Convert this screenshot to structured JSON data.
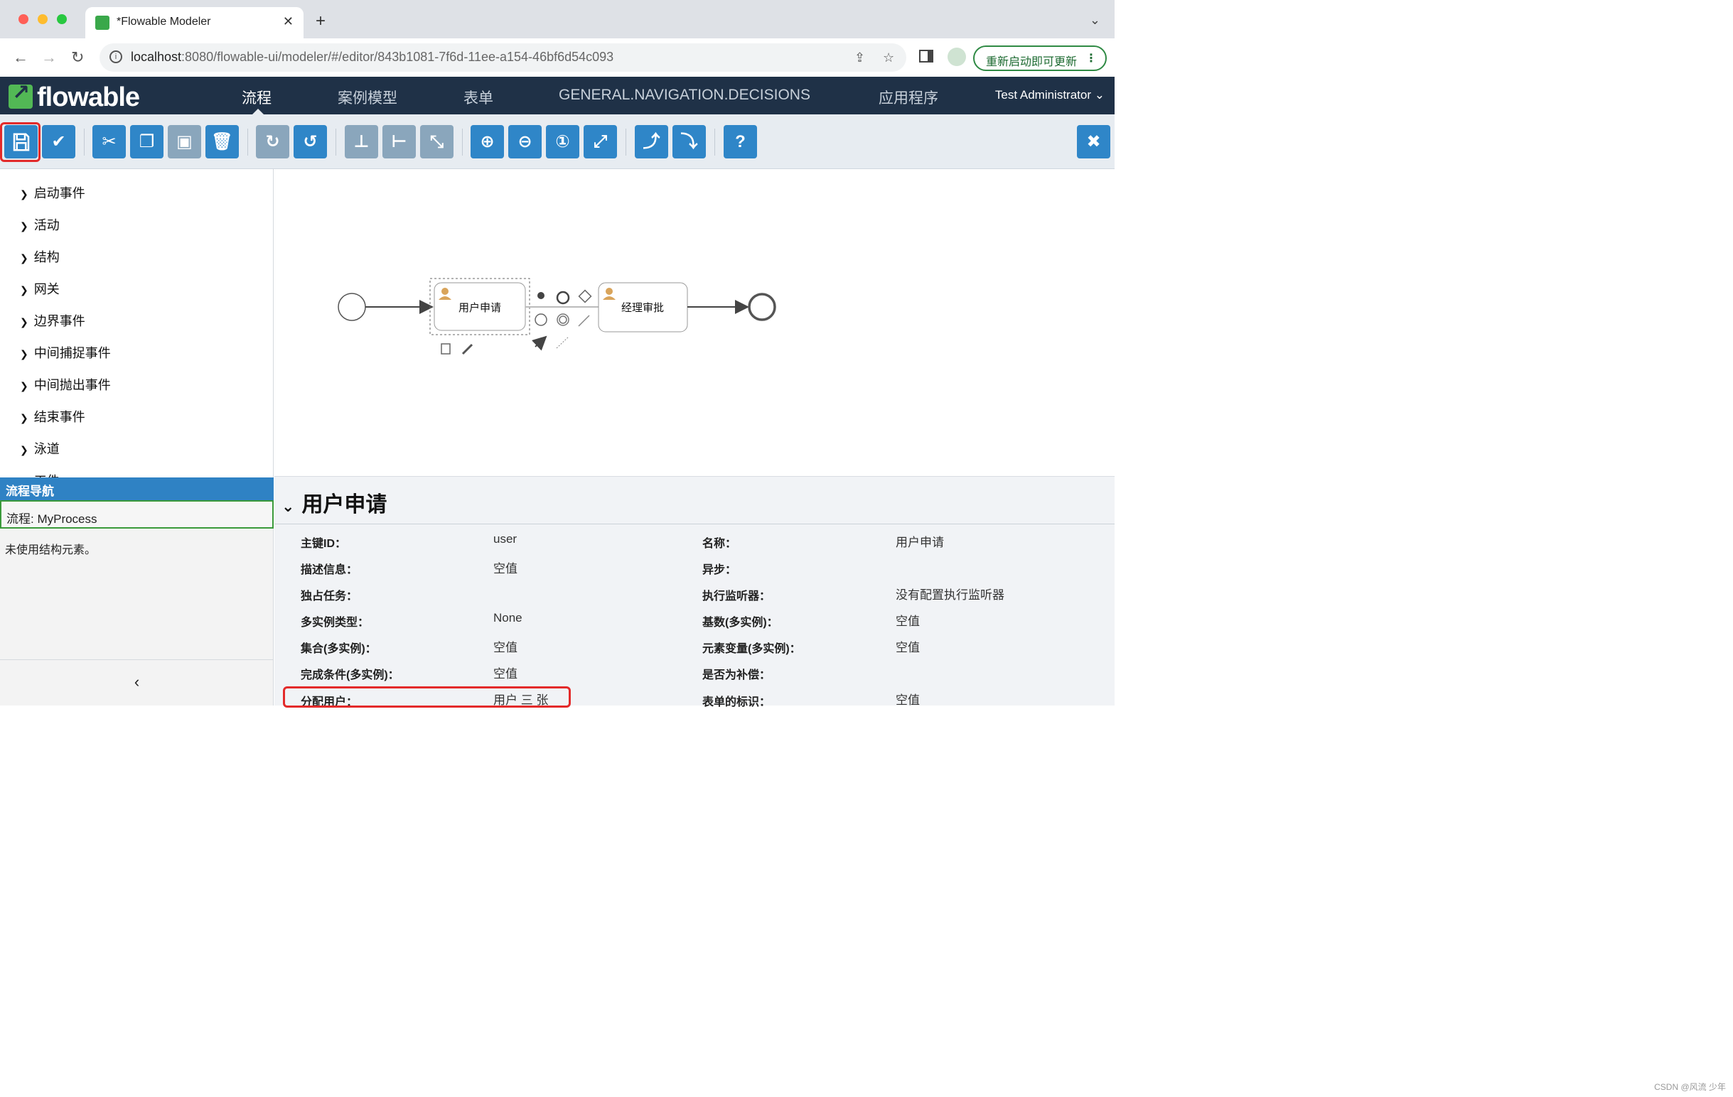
{
  "browser": {
    "tab_title": "*Flowable Modeler",
    "url_host": "localhost",
    "url_rest": ":8080/flowable-ui/modeler/#/editor/843b1081-7f6d-11ee-a154-46bf6d54c093",
    "update_button": "重新启动即可更新"
  },
  "app": {
    "logo": "flowable",
    "nav": [
      "流程",
      "案例模型",
      "表单",
      "GENERAL.NAVIGATION.DECISIONS",
      "应用程序"
    ],
    "user": "Test Administrator"
  },
  "palette": {
    "groups": [
      "启动事件",
      "活动",
      "结构",
      "网关",
      "边界事件",
      "中间捕捉事件",
      "中间抛出事件",
      "结束事件",
      "泳道",
      "工件"
    ]
  },
  "navigator": {
    "header": "流程导航",
    "process": "流程: MyProcess",
    "unused": "未使用结构元素。"
  },
  "diagram": {
    "task1": "用户申请",
    "task2": "经理审批"
  },
  "properties": {
    "title": "用户申请",
    "left": [
      {
        "label": "主键ID：",
        "value": "user"
      },
      {
        "label": "描述信息：",
        "value": "空值"
      },
      {
        "label": "独占任务：",
        "value": ""
      },
      {
        "label": "多实例类型：",
        "value": "None"
      },
      {
        "label": "集合(多实例)：",
        "value": "空值"
      },
      {
        "label": "完成条件(多实例)：",
        "value": "空值"
      },
      {
        "label": "分配用户：",
        "value": "用户 三 张"
      }
    ],
    "right": [
      {
        "label": "名称：",
        "value": "用户申请"
      },
      {
        "label": "异步：",
        "value": ""
      },
      {
        "label": "执行监听器：",
        "value": "没有配置执行监听器"
      },
      {
        "label": "基数(多实例)：",
        "value": "空值"
      },
      {
        "label": "元素变量(多实例)：",
        "value": "空值"
      },
      {
        "label": "是否为补偿：",
        "value": ""
      },
      {
        "label": "表单的标识：",
        "value": "空值"
      }
    ]
  },
  "watermark": "CSDN @风流 少年",
  "colors": {
    "header_bg": "#1f3147",
    "toolbar_btn": "#2f86c8",
    "highlight": "#e32a2a",
    "brand_green": "#52b855"
  }
}
